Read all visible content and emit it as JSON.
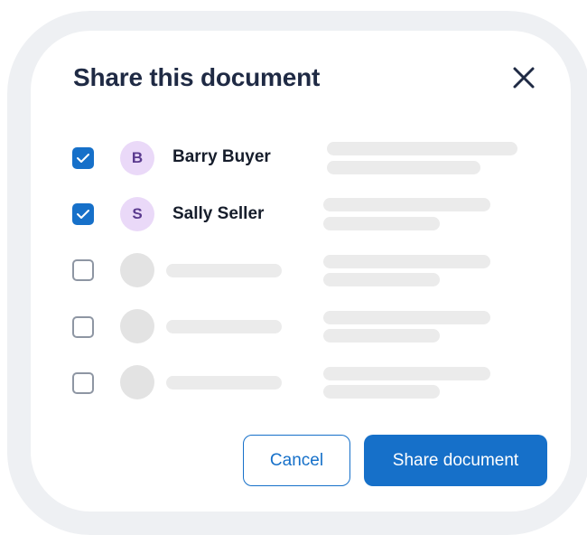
{
  "dialog": {
    "title": "Share this document",
    "close_icon": "close-icon"
  },
  "recipients": [
    {
      "initial": "B",
      "name": "Barry Buyer",
      "checked": true
    },
    {
      "initial": "S",
      "name": "Sally Seller",
      "checked": true
    },
    {
      "initial": "",
      "name": "",
      "checked": false
    },
    {
      "initial": "",
      "name": "",
      "checked": false
    },
    {
      "initial": "",
      "name": "",
      "checked": false
    }
  ],
  "actions": {
    "cancel_label": "Cancel",
    "share_label": "Share document"
  },
  "colors": {
    "primary": "#1670c9",
    "title": "#1f2a44",
    "avatar_bg": "#ead9f8",
    "avatar_fg": "#5a3a8e",
    "placeholder": "#ebebeb",
    "frame": "#eef0f3"
  }
}
